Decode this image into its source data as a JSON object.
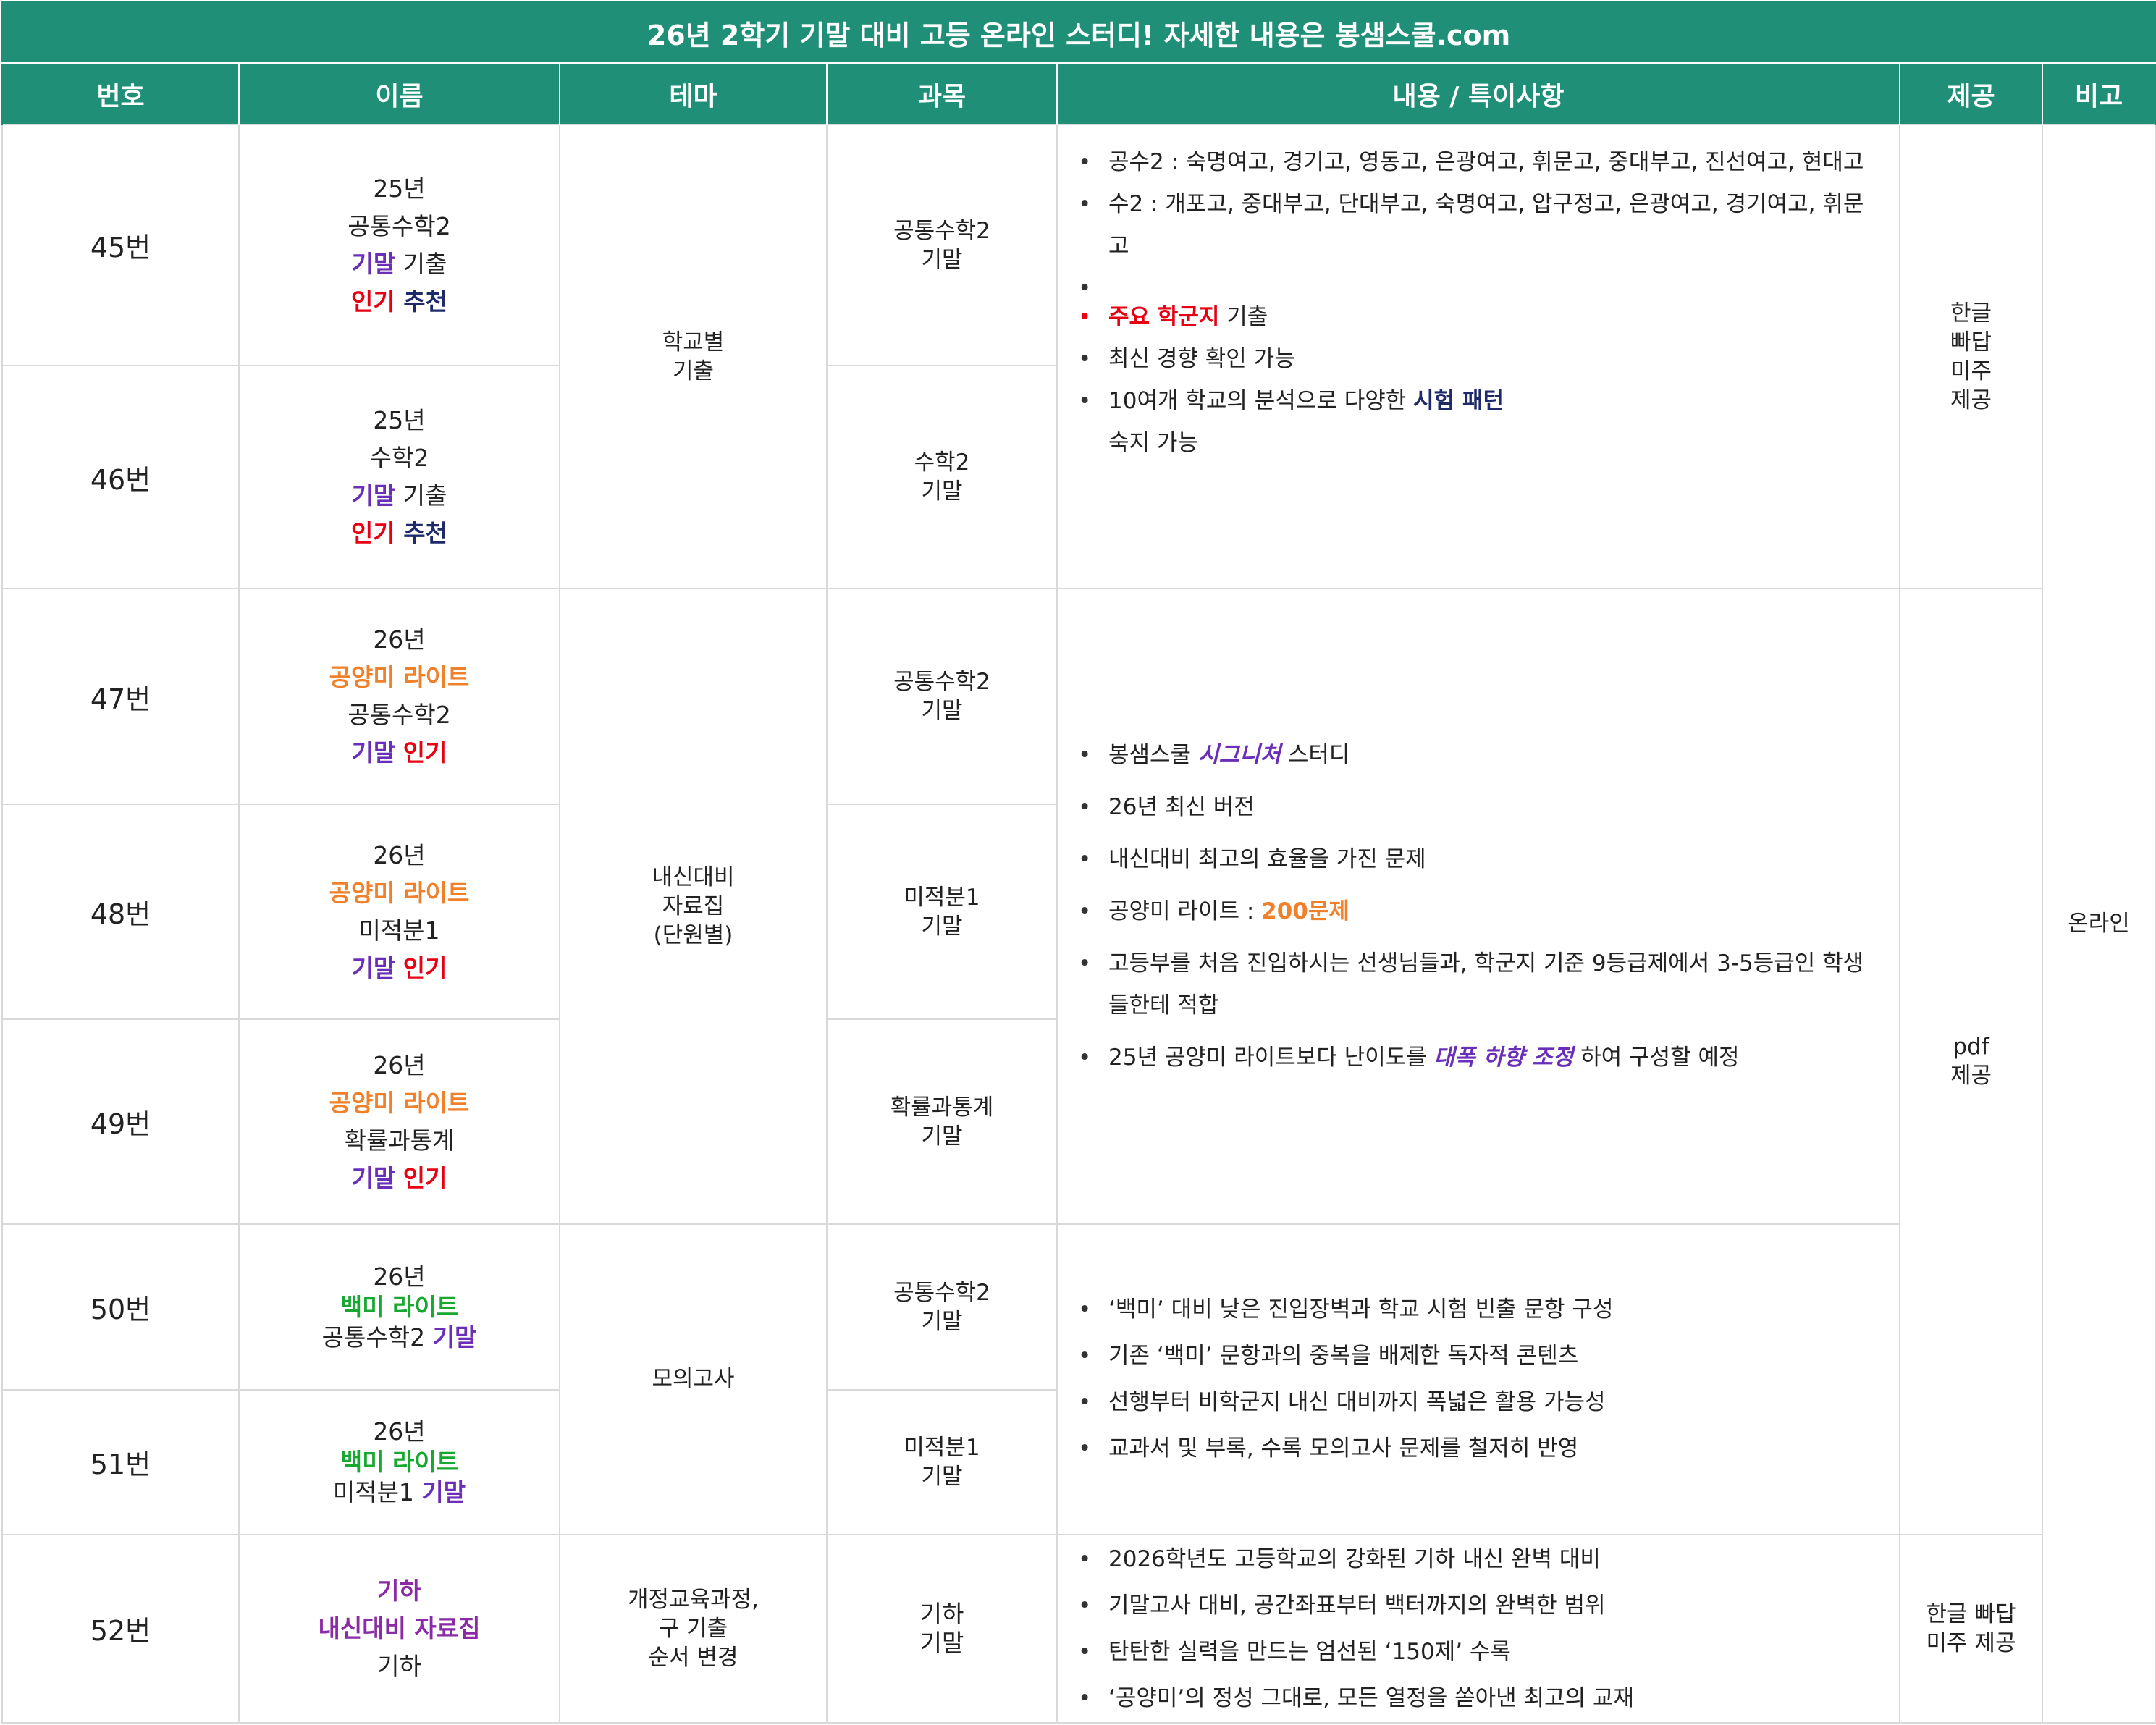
{
  "title": "26년 2학기 기말 대비 고등 온라인 스터디! 자세한 내용은 봉샘스쿨.com",
  "headers": [
    "번호",
    "이름",
    "테마",
    "과목",
    "내용 / 특이사항",
    "제공",
    "비고"
  ],
  "rows": [
    {
      "num": "45번",
      "name": [
        "25년",
        "공통수학2",
        {
          "a": "기말",
          "b": " 기출"
        },
        {
          "a": "인기",
          "b": " 추천"
        }
      ],
      "subject": [
        "공통수학2",
        "기말"
      ]
    },
    {
      "num": "46번",
      "name": [
        "25년",
        "수학2",
        {
          "a": "기말",
          "b": " 기출"
        },
        {
          "a": "인기",
          "b": " 추천"
        }
      ],
      "subject": [
        "수학2",
        "기말"
      ]
    },
    {
      "num": "47번",
      "name": [
        "26년",
        "공양미 라이트",
        "공통수학2",
        {
          "a": "기말",
          "b": "인기"
        }
      ],
      "subject": [
        "공통수학2",
        "기말"
      ]
    },
    {
      "num": "48번",
      "name": [
        "26년",
        "공양미 라이트",
        "미적분1",
        {
          "a": "기말",
          "b": "인기"
        }
      ],
      "subject": [
        "미적분1",
        "기말"
      ]
    },
    {
      "num": "49번",
      "name": [
        "26년",
        "공양미 라이트",
        "확률과통계",
        {
          "a": "기말",
          "b": "인기"
        }
      ],
      "subject": [
        "확률과통계",
        "기말"
      ]
    },
    {
      "num": "50번",
      "name": [
        "26년",
        "백미 라이트",
        {
          "a": "공통수학2 ",
          "b": "기말"
        }
      ],
      "subject": [
        "공통수학2",
        "기말"
      ]
    },
    {
      "num": "51번",
      "name": [
        "26년",
        "백미 라이트",
        {
          "a": "미적분1 ",
          "b": "기말"
        }
      ],
      "subject": [
        "미적분1",
        "기말"
      ]
    },
    {
      "num": "52번",
      "name": [
        "기하",
        "내신대비 자료집",
        "기하"
      ],
      "subject": [
        "기하",
        "기말"
      ]
    }
  ],
  "themes": {
    "g1": [
      "학교별",
      "기출"
    ],
    "g2": [
      "내신대비",
      "자료집",
      "(단원별)"
    ],
    "g3": [
      "모의고사"
    ],
    "g4": [
      "개정교육과정,",
      "구 기출",
      "순서 변경"
    ]
  },
  "content": {
    "g1": {
      "b1": "공수2 : 숙명여고, 경기고, 영동고, 은광여고, 휘문고, 중대부고, 진선여고, 현대고",
      "b2": "수2 : 개포고, 중대부고, 단대부고, 숙명여고, 압구정고, 은광여고, 경기여고, 휘문고",
      "b3a": "주요 학군지",
      "b3b": " 기출",
      "b4": "최신 경향 확인 가능",
      "b5a": "10여개 학교의 분석으로 다양한 ",
      "b5b": "시험 패턴",
      "b5c": "숙지 가능"
    },
    "g2": {
      "b1a": "봉샘스쿨 ",
      "b1b": "시그니처",
      "b1c": " 스터디",
      "b2": "26년 최신 버전",
      "b3": "내신대비 최고의 효율을 가진 문제",
      "b4a": "공양미 라이트 : ",
      "b4b": "200문제",
      "b5": "고등부를 처음 진입하시는 선생님들과, 학군지 기준 9등급제에서 3-5등급인 학생들한테 적합",
      "b6a": "25년 공양미 라이트보다 난이도를 ",
      "b6b": "대폭 하향 조정",
      "b6c": " 하여 구성할 예정"
    },
    "g3": {
      "b1": "‘백미’ 대비 낮은 진입장벽과 학교 시험 빈출 문항 구성",
      "b2": "기존 ‘백미’ 문항과의 중복을 배제한 독자적 콘텐츠",
      "b3": "선행부터 비학군지 내신 대비까지 폭넓은 활용 가능성",
      "b4": "교과서 및 부록, 수록 모의고사 문제를 철저히 반영"
    },
    "g4": {
      "b1": "2026학년도 고등학교의 강화된 기하 내신 완벽 대비",
      "b2": "기말고사 대비, 공간좌표부터 백터까지의 완벽한 범위",
      "b3": "탄탄한 실력을 만드는 엄선된 ‘150제’ 수록",
      "b4": "‘공양미’의 정성 그대로, 모든 열정을 쏟아낸 최고의 교재"
    }
  },
  "provide": {
    "g1": [
      "한글",
      "빠답",
      "미주",
      "제공"
    ],
    "g2": [
      "pdf",
      "제공"
    ],
    "g3": [
      "한글 빠답",
      "미주 제공"
    ]
  },
  "note": "온라인",
  "colors": {
    "header_bg": "#1f8f77",
    "purple": "#6a2eb8",
    "red": "#e60012",
    "navy": "#1f2a6b",
    "orange": "#f0812a",
    "green": "#18a832",
    "magenta": "#8a2aa6"
  }
}
